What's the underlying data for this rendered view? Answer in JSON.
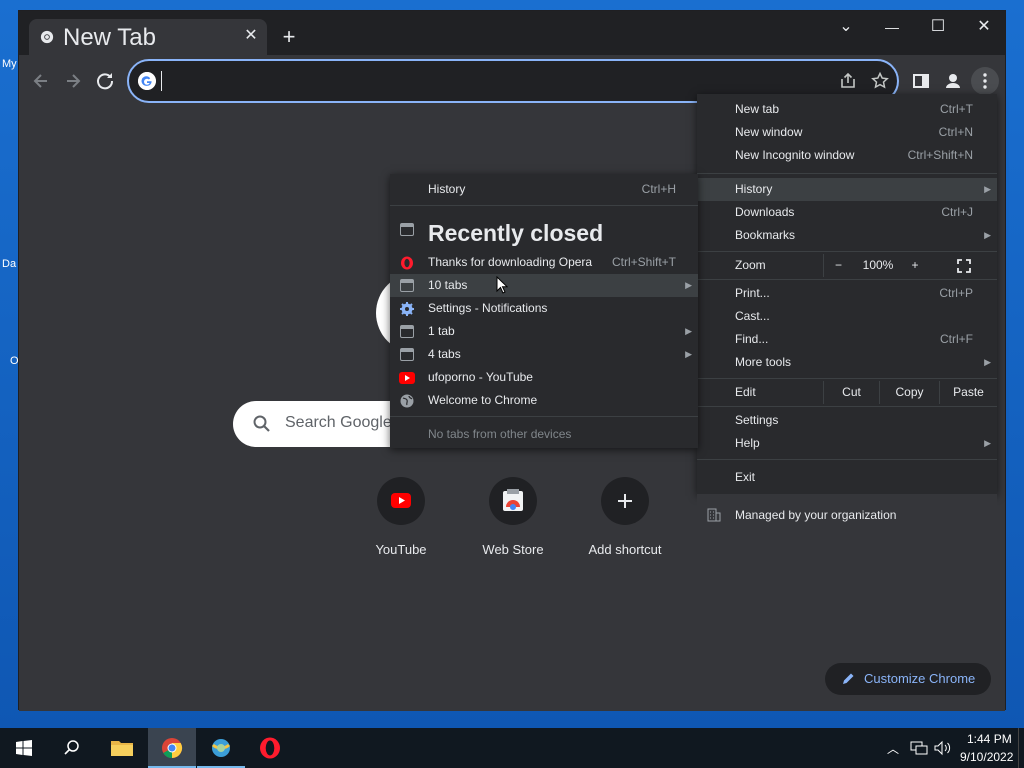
{
  "desktop": {
    "icon_labels": [
      "My",
      "Da",
      "O"
    ]
  },
  "tab": {
    "title": "New Tab",
    "close": "✕"
  },
  "new_tab_button": "+",
  "window_controls": {
    "tab_search": "⌄",
    "minimize": "—",
    "maximize": "☐",
    "close": "✕"
  },
  "omnibox": {
    "value": "",
    "placeholder": ""
  },
  "ntp": {
    "search_placeholder": "Search Google",
    "shortcuts": [
      {
        "label": "YouTube"
      },
      {
        "label": "Web Store"
      },
      {
        "label": "Add shortcut"
      }
    ],
    "customize_label": "Customize Chrome"
  },
  "chrome_menu": {
    "new_tab": {
      "label": "New tab",
      "shortcut": "Ctrl+T"
    },
    "new_window": {
      "label": "New window",
      "shortcut": "Ctrl+N"
    },
    "new_incognito": {
      "label": "New Incognito window",
      "shortcut": "Ctrl+Shift+N"
    },
    "history": {
      "label": "History"
    },
    "downloads": {
      "label": "Downloads",
      "shortcut": "Ctrl+J"
    },
    "bookmarks": {
      "label": "Bookmarks"
    },
    "zoom": {
      "label": "Zoom",
      "minus": "−",
      "level": "100%",
      "plus": "+"
    },
    "print": {
      "label": "Print...",
      "shortcut": "Ctrl+P"
    },
    "cast": {
      "label": "Cast..."
    },
    "find": {
      "label": "Find...",
      "shortcut": "Ctrl+F"
    },
    "more_tools": {
      "label": "More tools"
    },
    "edit": {
      "label": "Edit",
      "cut": "Cut",
      "copy": "Copy",
      "paste": "Paste"
    },
    "settings": {
      "label": "Settings"
    },
    "help": {
      "label": "Help"
    },
    "exit": {
      "label": "Exit"
    },
    "managed": {
      "label": "Managed by your organization"
    }
  },
  "history_menu": {
    "history": {
      "label": "History",
      "shortcut": "Ctrl+H"
    },
    "recently_closed": "Recently closed",
    "items": [
      {
        "label": "Thanks for downloading Opera",
        "shortcut": "Ctrl+Shift+T",
        "icon": "opera-icon"
      },
      {
        "label": "10 tabs",
        "icon": "window-icon",
        "submenu": true
      },
      {
        "label": "Settings - Notifications",
        "icon": "settings-gear-icon"
      },
      {
        "label": "1 tab",
        "icon": "window-icon",
        "submenu": true
      },
      {
        "label": "4 tabs",
        "icon": "window-icon",
        "submenu": true
      },
      {
        "label": "ufoporno - YouTube",
        "icon": "youtube-icon"
      },
      {
        "label": "Welcome to Chrome",
        "icon": "globe-icon"
      }
    ],
    "no_tabs": "No tabs from other devices"
  },
  "taskbar": {
    "time": "1:44 PM",
    "date": "9/10/2022"
  }
}
